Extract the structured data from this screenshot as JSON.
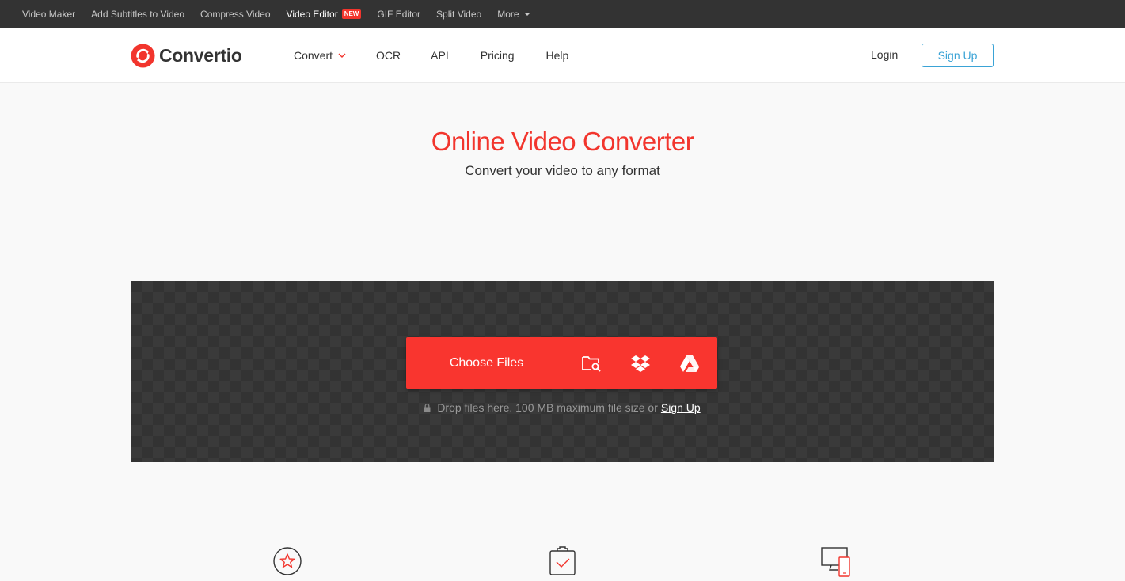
{
  "topbar": {
    "links": [
      {
        "label": "Video Maker"
      },
      {
        "label": "Add Subtitles to Video"
      },
      {
        "label": "Compress Video"
      },
      {
        "label": "Video Editor",
        "badge": "NEW"
      },
      {
        "label": "GIF Editor"
      },
      {
        "label": "Split Video"
      },
      {
        "label": "More"
      }
    ]
  },
  "header": {
    "brand": "Convertio",
    "nav": [
      "Convert",
      "OCR",
      "API",
      "Pricing",
      "Help"
    ],
    "login": "Login",
    "signup": "Sign Up"
  },
  "hero": {
    "title": "Online Video Converter",
    "subtitle": "Convert your video to any format"
  },
  "upload": {
    "choose_label": "Choose Files",
    "sources": [
      "folder-search-icon",
      "dropbox-icon",
      "google-drive-icon"
    ],
    "drop_text": "Drop files here. 100 MB maximum file size or",
    "drop_link": "Sign Up"
  },
  "features": {
    "icons": [
      "star-badge-icon",
      "clipboard-check-icon",
      "devices-icon"
    ]
  },
  "colors": {
    "brand_red": "#f2352d",
    "button_red": "#f9352f",
    "signup_blue": "#3aa3d6",
    "topbar_bg": "#333333"
  }
}
